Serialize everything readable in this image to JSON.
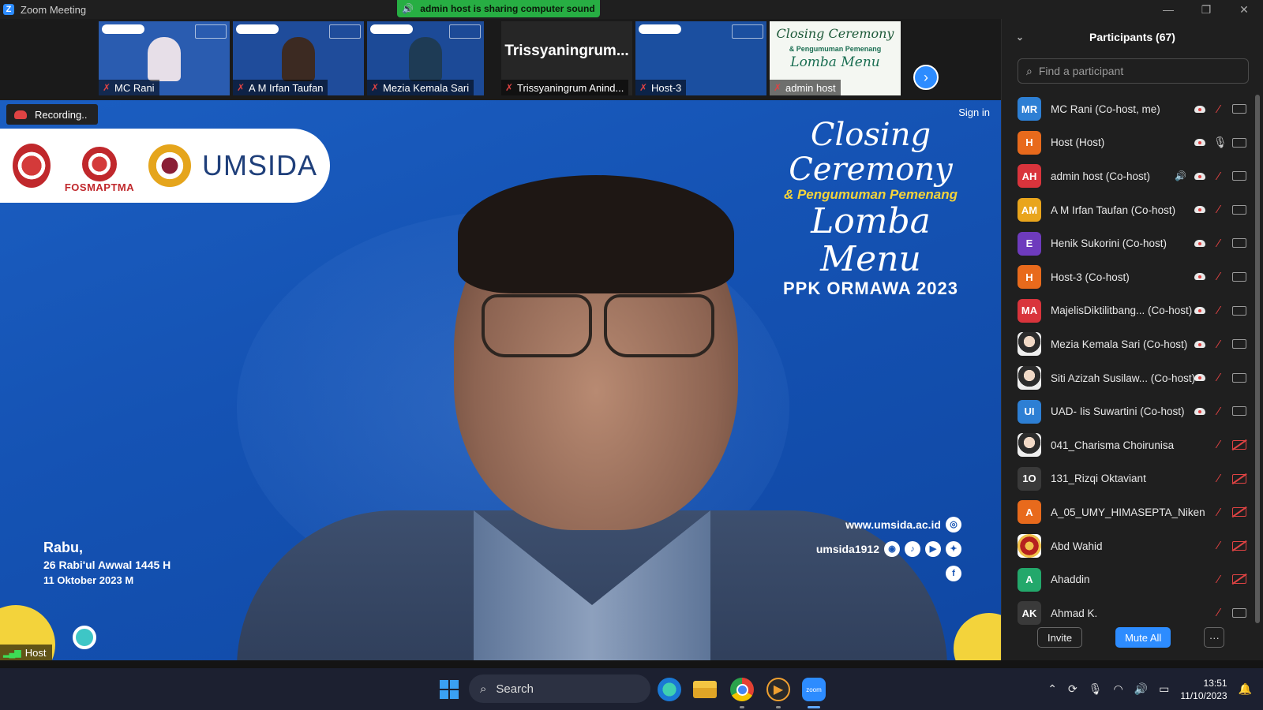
{
  "window": {
    "title": "Zoom Meeting",
    "controls": [
      "—",
      "❐",
      "✕"
    ]
  },
  "sharing_banner": "admin host is sharing computer sound",
  "thumbnails": [
    {
      "label": "MC Rani",
      "face_color": "#e7dfe8"
    },
    {
      "label": "A M Irfan Taufan",
      "face_color": "#3c2a22"
    },
    {
      "label": "Mezia Kemala Sari",
      "face_color": "#1e3b55"
    },
    {
      "label": "Trissyaningrum Anind...",
      "big_name": "Trissyaningrum..."
    },
    {
      "label": "Host-3",
      "face_color": "#1b4fa0"
    },
    {
      "label": "admin host",
      "poster": {
        "line1": "Closing Ceremony",
        "line2": "& Pengumuman Pemenang",
        "line3": "Lomba Menu"
      }
    }
  ],
  "main": {
    "recording_label": "Recording..",
    "sign_in": "Sign in",
    "logos": {
      "fosmaptma": "FOSMAPTMA",
      "umsida": "UMSIDA"
    },
    "event_title": {
      "line1": "Closing Ceremony",
      "line2": "& Pengumuman Pemenang",
      "line3": "Lomba Menu",
      "line4": "PPK ORMAWA 2023"
    },
    "contacts": {
      "website": "www.umsida.ac.id",
      "social": "umsida1912"
    },
    "date": {
      "day": "Rabu,",
      "hijri": "26 Rabi'ul Awwal 1445 H",
      "gregorian": "11 Oktober 2023 M"
    },
    "host_label": "Host"
  },
  "panel": {
    "title": "Participants (67)",
    "search_placeholder": "Find a participant",
    "participants": [
      {
        "initials": "MR",
        "color": "#2d7fd4",
        "name": "MC Rani (Co-host, me)",
        "cloud": true,
        "speaker": false,
        "mic": "off",
        "cam": "on"
      },
      {
        "initials": "H",
        "color": "#e86a1c",
        "name": "Host (Host)",
        "cloud": true,
        "speaker": false,
        "mic": "on",
        "cam": "on"
      },
      {
        "initials": "AH",
        "color": "#d9343c",
        "name": "admin host (Co-host)",
        "cloud": true,
        "speaker": true,
        "mic": "off",
        "cam": "on"
      },
      {
        "initials": "AM",
        "color": "#e9a51c",
        "name": "A M Irfan Taufan (Co-host)",
        "cloud": true,
        "speaker": false,
        "mic": "off",
        "cam": "on"
      },
      {
        "initials": "E",
        "color": "#6e3bbd",
        "name": "Henik Sukorini (Co-host)",
        "cloud": true,
        "speaker": false,
        "mic": "off",
        "cam": "on"
      },
      {
        "initials": "H",
        "color": "#e86a1c",
        "name": "Host-3 (Co-host)",
        "cloud": true,
        "speaker": false,
        "mic": "off",
        "cam": "on"
      },
      {
        "initials": "MA",
        "color": "#d9343c",
        "name": "MajelisDiktilitbang... (Co-host)",
        "cloud": true,
        "speaker": false,
        "mic": "off",
        "cam": "on"
      },
      {
        "initials": "",
        "color": "photo",
        "name": "Mezia Kemala Sari (Co-host)",
        "cloud": true,
        "speaker": false,
        "mic": "off",
        "cam": "on"
      },
      {
        "initials": "",
        "color": "photo",
        "name": "Siti Azizah Susilaw... (Co-host)",
        "cloud": true,
        "speaker": false,
        "mic": "off",
        "cam": "on"
      },
      {
        "initials": "UI",
        "color": "#2d7fd4",
        "name": "UAD- Iis Suwartini (Co-host)",
        "cloud": true,
        "speaker": false,
        "mic": "off",
        "cam": "on"
      },
      {
        "initials": "",
        "color": "photo",
        "name": "041_Charisma Choirunisa",
        "cloud": false,
        "speaker": false,
        "mic": "off",
        "cam": "off"
      },
      {
        "initials": "1O",
        "color": "#3a3a3a",
        "name": "131_Rizqi Oktaviant",
        "cloud": false,
        "speaker": false,
        "mic": "off",
        "cam": "off"
      },
      {
        "initials": "A",
        "color": "#e86a1c",
        "name": "A_05_UMY_HIMASEPTA_Niken",
        "cloud": false,
        "speaker": false,
        "mic": "off",
        "cam": "off"
      },
      {
        "initials": "",
        "color": "seal",
        "name": "Abd Wahid",
        "cloud": false,
        "speaker": false,
        "mic": "off",
        "cam": "off"
      },
      {
        "initials": "A",
        "color": "#23a86b",
        "name": "Ahaddin",
        "cloud": false,
        "speaker": false,
        "mic": "off",
        "cam": "off"
      },
      {
        "initials": "AK",
        "color": "#3a3a3a",
        "name": "Ahmad K.",
        "cloud": false,
        "speaker": false,
        "mic": "off",
        "cam": "on"
      }
    ],
    "invite": "Invite",
    "mute_all": "Mute All",
    "more": "···"
  },
  "taskbar": {
    "search_label": "Search",
    "zoom_label": "zoom",
    "time": "13:51",
    "date": "11/10/2023"
  }
}
